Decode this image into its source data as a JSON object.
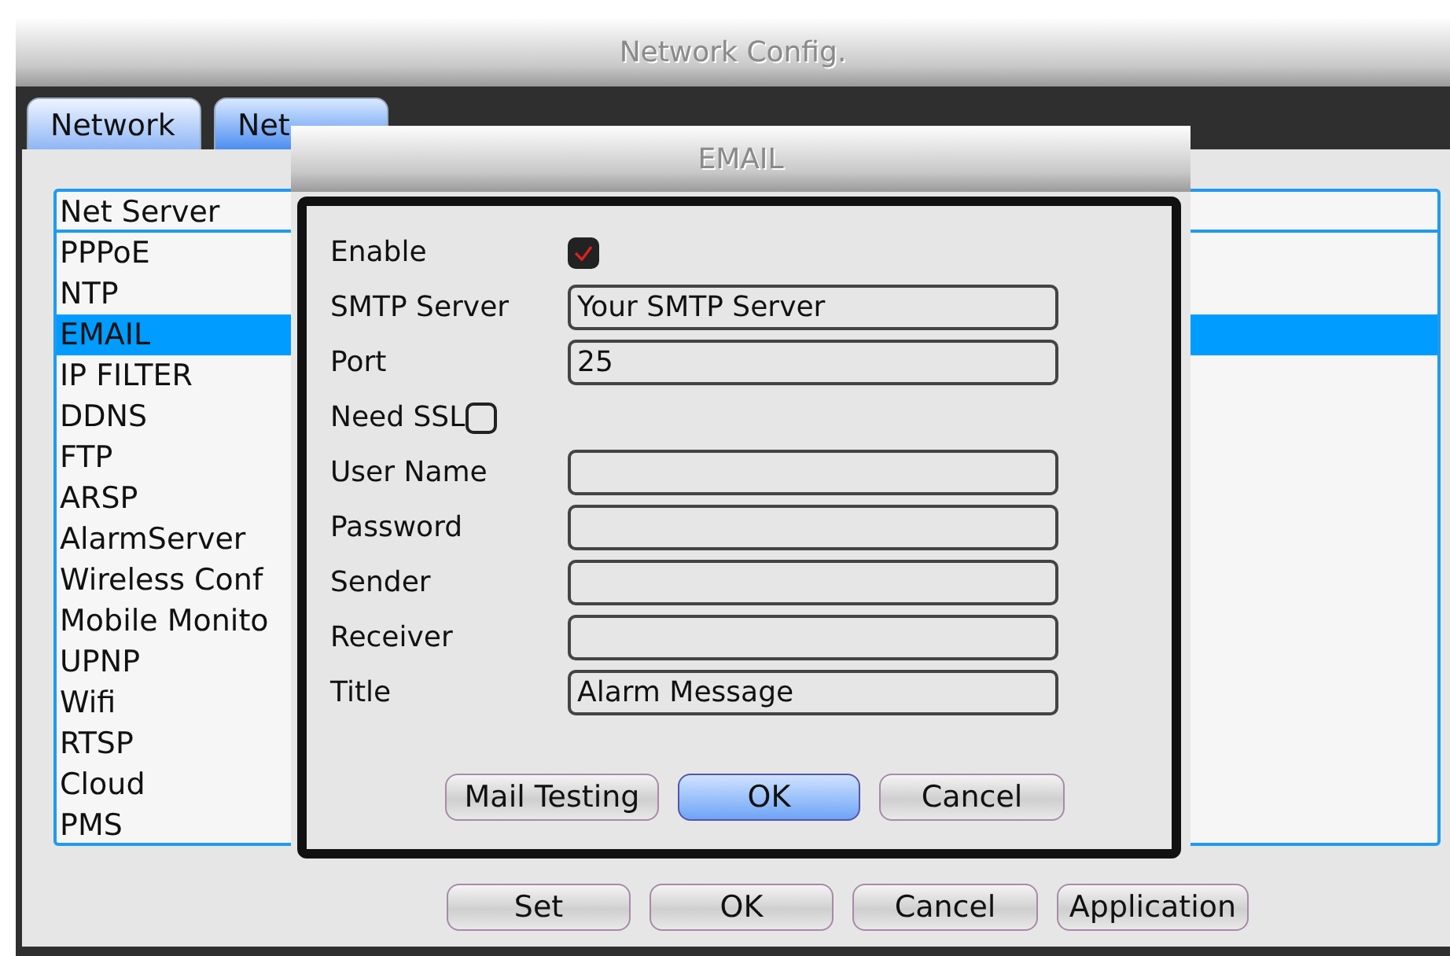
{
  "window": {
    "title": "Network Config."
  },
  "tabs": [
    {
      "label": "Network",
      "selected": false
    },
    {
      "label": "Net",
      "selected": true
    }
  ],
  "net_server": {
    "header": "Net Server",
    "items": [
      {
        "label": "PPPoE",
        "selected": false
      },
      {
        "label": "NTP",
        "selected": false
      },
      {
        "label": "EMAIL",
        "selected": true
      },
      {
        "label": "IP FILTER",
        "selected": false
      },
      {
        "label": "DDNS",
        "selected": false
      },
      {
        "label": "FTP",
        "selected": false
      },
      {
        "label": "ARSP",
        "selected": false
      },
      {
        "label": "AlarmServer",
        "selected": false
      },
      {
        "label": "Wireless Conf",
        "selected": false
      },
      {
        "label": "Mobile Monito",
        "selected": false
      },
      {
        "label": "UPNP",
        "selected": false
      },
      {
        "label": "Wifi",
        "selected": false
      },
      {
        "label": "RTSP",
        "selected": false
      },
      {
        "label": "Cloud",
        "selected": false
      },
      {
        "label": "PMS",
        "selected": false
      }
    ]
  },
  "buttons": [
    "Set",
    "OK",
    "Cancel",
    "Application"
  ],
  "dialog": {
    "title": "EMAIL",
    "fields": [
      {
        "kind": "checkbox",
        "label": "Enable",
        "checked": true
      },
      {
        "kind": "text",
        "label": "SMTP Server",
        "value": "Your SMTP Server"
      },
      {
        "kind": "text",
        "label": "Port",
        "value": "25"
      },
      {
        "kind": "inline_checkbox",
        "label": "Need SSL",
        "checked": false
      },
      {
        "kind": "text",
        "label": "User Name"
      },
      {
        "kind": "text",
        "label": "Password"
      },
      {
        "kind": "text",
        "label": "Sender"
      },
      {
        "kind": "text",
        "label": "Receiver"
      },
      {
        "kind": "text",
        "label": "Title",
        "value": "Alarm Message"
      }
    ],
    "buttons": [
      {
        "label": "Mail Testing",
        "selected": false
      },
      {
        "label": "OK",
        "selected": true
      },
      {
        "label": "Cancel",
        "selected": false
      }
    ]
  }
}
